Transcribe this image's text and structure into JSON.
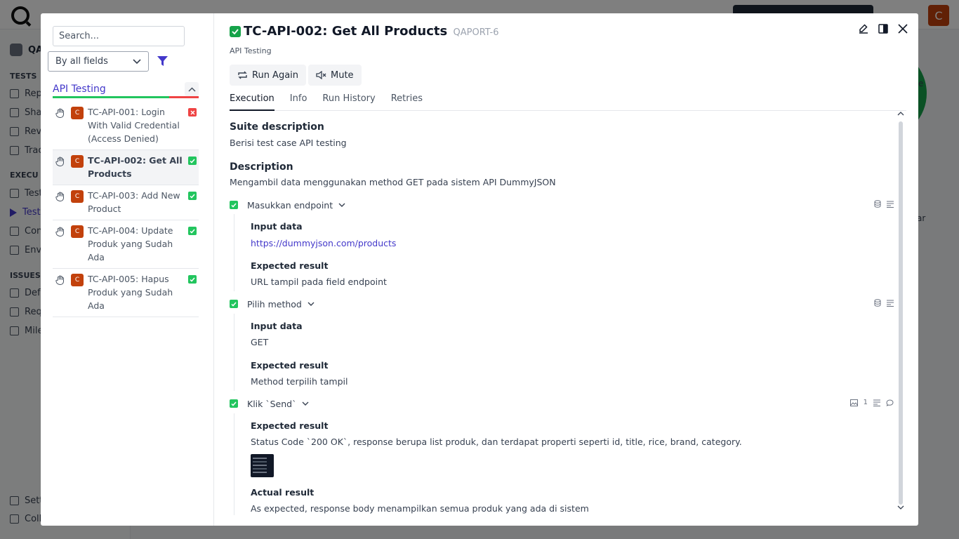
{
  "background": {
    "avatar_letter": "C",
    "sidebar_project": "QA",
    "sections": [
      {
        "label": "TESTS",
        "items": [
          "Rep",
          "Sha",
          "Revi",
          "Trac"
        ]
      },
      {
        "label": "EXECU",
        "items": [
          "Test",
          "Test",
          "Con",
          "Envi"
        ]
      },
      {
        "label": "ISSUES",
        "items": [
          "Defe",
          "Req",
          "Mile"
        ]
      }
    ],
    "footer_items": [
      "Sett",
      "Coll"
    ],
    "right_texts": [
      "e",
      "ar"
    ]
  },
  "left_panel": {
    "search_placeholder": "Search...",
    "filter_value": "By all fields",
    "suite_title": "API Testing",
    "progress": {
      "passed_fraction": 0.8,
      "failed_fraction": 0.2
    },
    "cases": [
      {
        "priority": "C",
        "name": "TC-API-001: Login With Valid Credential (Access Denied)",
        "status": "failed"
      },
      {
        "priority": "C",
        "name": "TC-API-002: Get All Products",
        "status": "passed",
        "selected": true
      },
      {
        "priority": "C",
        "name": "TC-API-003: Add New Product",
        "status": "passed"
      },
      {
        "priority": "C",
        "name": "TC-API-004: Update Produk yang Sudah Ada",
        "status": "passed"
      },
      {
        "priority": "C",
        "name": "TC-API-005: Hapus Produk yang Sudah Ada",
        "status": "passed"
      }
    ]
  },
  "detail": {
    "title": "TC-API-002: Get All Products",
    "key": "QAPORT-6",
    "suite": "API Testing",
    "buttons": {
      "run_again": "Run Again",
      "mute": "Mute"
    },
    "tabs": [
      "Execution",
      "Info",
      "Run History",
      "Retries"
    ],
    "suite_description_label": "Suite description",
    "suite_description": "Berisi test case API testing",
    "description_label": "Description",
    "description": "Mengambil data menggunakan method GET pada sistem API DummyJSON",
    "steps": [
      {
        "name": "Masukkan endpoint",
        "input_label": "Input data",
        "input": "https://dummyjson.com/products",
        "expected_label": "Expected result",
        "expected": "URL tampil pada field endpoint"
      },
      {
        "name": "Pilih method",
        "input_label": "Input data",
        "input": "GET",
        "expected_label": "Expected result",
        "expected": "Method terpilih tampil"
      },
      {
        "name": "Klik `Send`",
        "attachments_count": "1",
        "expected_label": "Expected result",
        "expected": "Status Code `200 OK`, response berupa list produk, dan terdapat properti seperti id, title, rice, brand, category.",
        "actual_label": "Actual result",
        "actual": "As expected, response body menampilkan semua produk yang ada di sistem"
      }
    ]
  },
  "colors": {
    "accent": "#4338ca",
    "passed": "#22c55e",
    "failed": "#ef4444",
    "priority": "#c2410c"
  }
}
